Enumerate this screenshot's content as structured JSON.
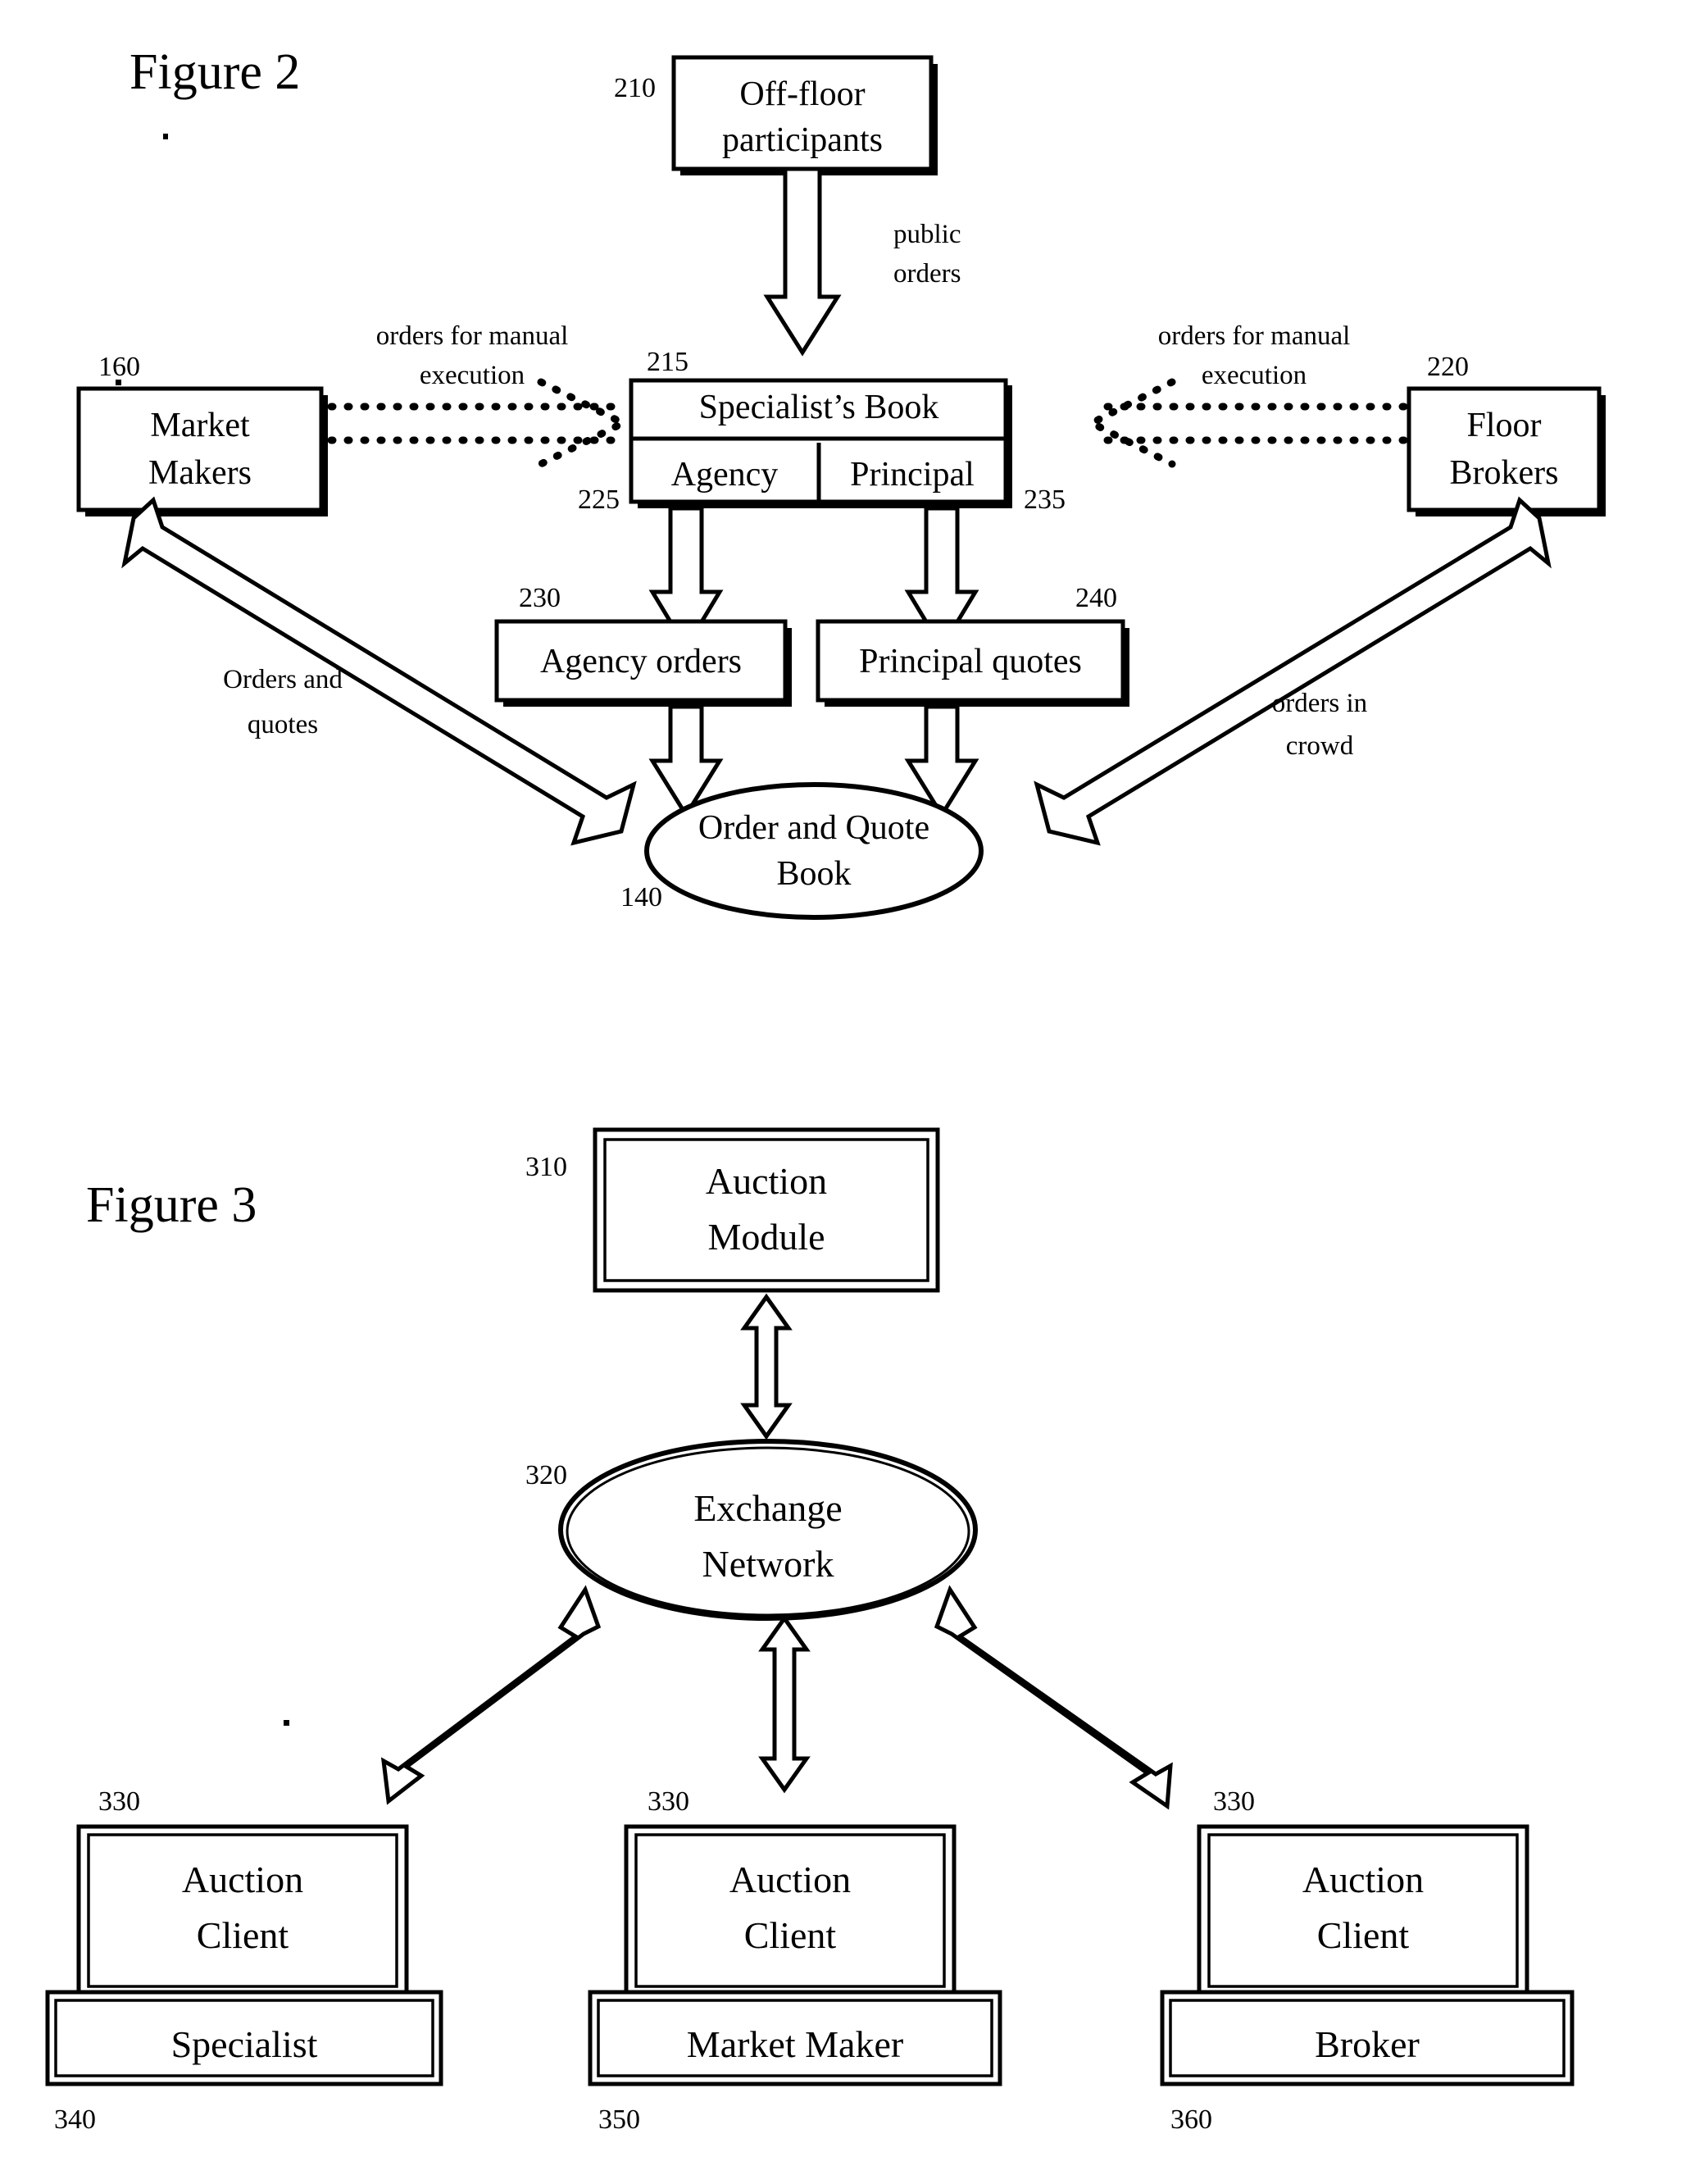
{
  "figures": [
    {
      "id": "figure-2",
      "title": "Figure 2",
      "nodes": {
        "off_floor": {
          "ref": "210",
          "line1": "Off-floor",
          "line2": "participants"
        },
        "market_makers": {
          "ref": "160",
          "line1": "Market",
          "line2": "Makers"
        },
        "floor_brokers": {
          "ref": "220",
          "line1": "Floor",
          "line2": "Brokers"
        },
        "specialists_book": {
          "ref": "215",
          "label": "Specialist’s Book"
        },
        "agency_cell": {
          "ref": "225",
          "label": "Agency"
        },
        "principal_cell": {
          "ref": "235",
          "label": "Principal"
        },
        "agency_orders": {
          "ref": "230",
          "label": "Agency orders"
        },
        "principal_quotes": {
          "ref": "240",
          "label": "Principal quotes"
        },
        "order_quote_book": {
          "ref": "140",
          "line1": "Order and Quote",
          "line2": "Book"
        }
      },
      "edges": {
        "public_orders": {
          "line1": "public",
          "line2": "orders"
        },
        "manual_left": {
          "line1": "orders for manual",
          "line2": "execution"
        },
        "manual_right": {
          "line1": "orders for manual",
          "line2": "execution"
        },
        "orders_and_quotes": {
          "line1": "Orders and",
          "line2": "quotes"
        },
        "orders_in_crowd": {
          "line1": "orders in",
          "line2": "crowd"
        }
      }
    },
    {
      "id": "figure-3",
      "title": "Figure 3",
      "nodes": {
        "auction_module": {
          "ref": "310",
          "line1": "Auction",
          "line2": "Module"
        },
        "exchange_network": {
          "ref": "320",
          "line1": "Exchange",
          "line2": "Network"
        },
        "client_left": {
          "ref": "330",
          "line1": "Auction",
          "line2": "Client"
        },
        "client_mid": {
          "ref": "330",
          "line1": "Auction",
          "line2": "Client"
        },
        "client_right": {
          "ref": "330",
          "line1": "Auction",
          "line2": "Client"
        },
        "role_left": {
          "ref": "340",
          "label": "Specialist"
        },
        "role_mid": {
          "ref": "350",
          "label": "Market Maker"
        },
        "role_right": {
          "ref": "360",
          "label": "Broker"
        }
      }
    }
  ],
  "colors": {
    "ink": "#000000",
    "paper": "#ffffff"
  }
}
